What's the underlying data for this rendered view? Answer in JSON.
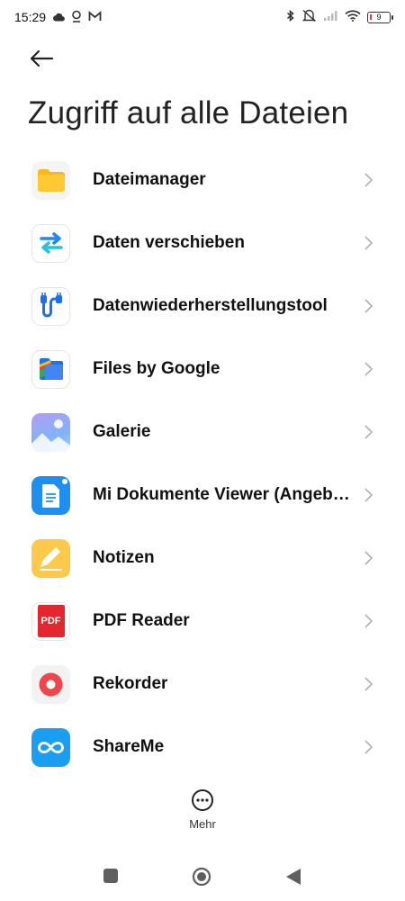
{
  "status_bar": {
    "time": "15:29",
    "battery_level": "9",
    "icons_left": [
      "cloud-icon",
      "location-pin-icon",
      "gmail-icon"
    ],
    "icons_right": [
      "bluetooth-icon",
      "mute-icon",
      "signal-icon",
      "wifi-icon",
      "battery-icon"
    ]
  },
  "header": {
    "title": "Zugriff auf alle Dateien"
  },
  "apps": [
    {
      "label": "Dateimanager",
      "icon": "folder-icon"
    },
    {
      "label": "Daten verschieben",
      "icon": "transfer-arrows-icon"
    },
    {
      "label": "Datenwiederherstellungstool",
      "icon": "cable-icon"
    },
    {
      "label": "Files by Google",
      "icon": "files-google-icon"
    },
    {
      "label": "Galerie",
      "icon": "gallery-icon"
    },
    {
      "label": "Mi Dokumente Viewer (Angeb…",
      "icon": "document-icon"
    },
    {
      "label": "Notizen",
      "icon": "notes-icon"
    },
    {
      "label": "PDF Reader",
      "icon": "pdf-icon",
      "icon_text": "PDF"
    },
    {
      "label": "Rekorder",
      "icon": "recorder-icon"
    },
    {
      "label": "ShareMe",
      "icon": "shareme-icon"
    }
  ],
  "more": {
    "label": "Mehr"
  },
  "colors": {
    "background": "#ffffff",
    "text": "#111111",
    "chevron": "#b0b0b0",
    "folder": "#f9b81b",
    "pdf_red": "#e4262f",
    "shareme_blue": "#1a9ef2"
  }
}
